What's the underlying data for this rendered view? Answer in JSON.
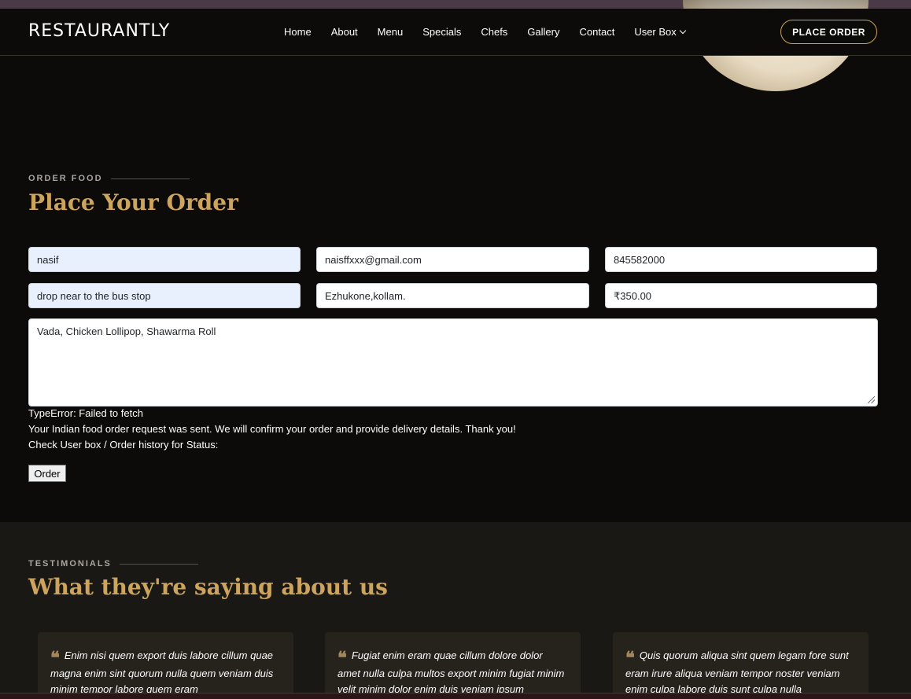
{
  "header": {
    "logo": "RESTAURANTLY",
    "nav": [
      "Home",
      "About",
      "Menu",
      "Specials",
      "Chefs",
      "Gallery",
      "Contact"
    ],
    "user_box": "User Box",
    "place_order": "PLACE ORDER"
  },
  "order": {
    "tag": "ORDER FOOD",
    "title": "Place Your Order",
    "name": "nasif",
    "email": "naisffxxx@gmail.com",
    "phone": "845582000",
    "note": "drop near to the bus stop",
    "address": "Ezhukone,kollam.",
    "price": "₹350.00",
    "items": "Vada, Chicken Lollipop, Shawarma Roll",
    "error": "TypeError: Failed to fetch",
    "sent_message": "Your Indian food order request was sent. We will confirm your order and provide delivery details. Thank you!",
    "status_message": "Check User box / Order history for Status:",
    "order_button": "Order"
  },
  "testimonials": {
    "tag": "TESTIMONIALS",
    "title": "What they're saying about us",
    "quotes": [
      "Enim nisi quem export duis labore cillum quae magna enim sint quorum nulla quem veniam duis minim tempor labore quem eram",
      "Fugiat enim eram quae cillum dolore dolor amet nulla culpa multos export minim fugiat minim velit minim dolor enim duis veniam ipsum",
      "Quis quorum aliqua sint quem legam fore sunt eram irure aliqua veniam tempor noster veniam enim culpa labore duis sunt culpa nulla"
    ]
  }
}
